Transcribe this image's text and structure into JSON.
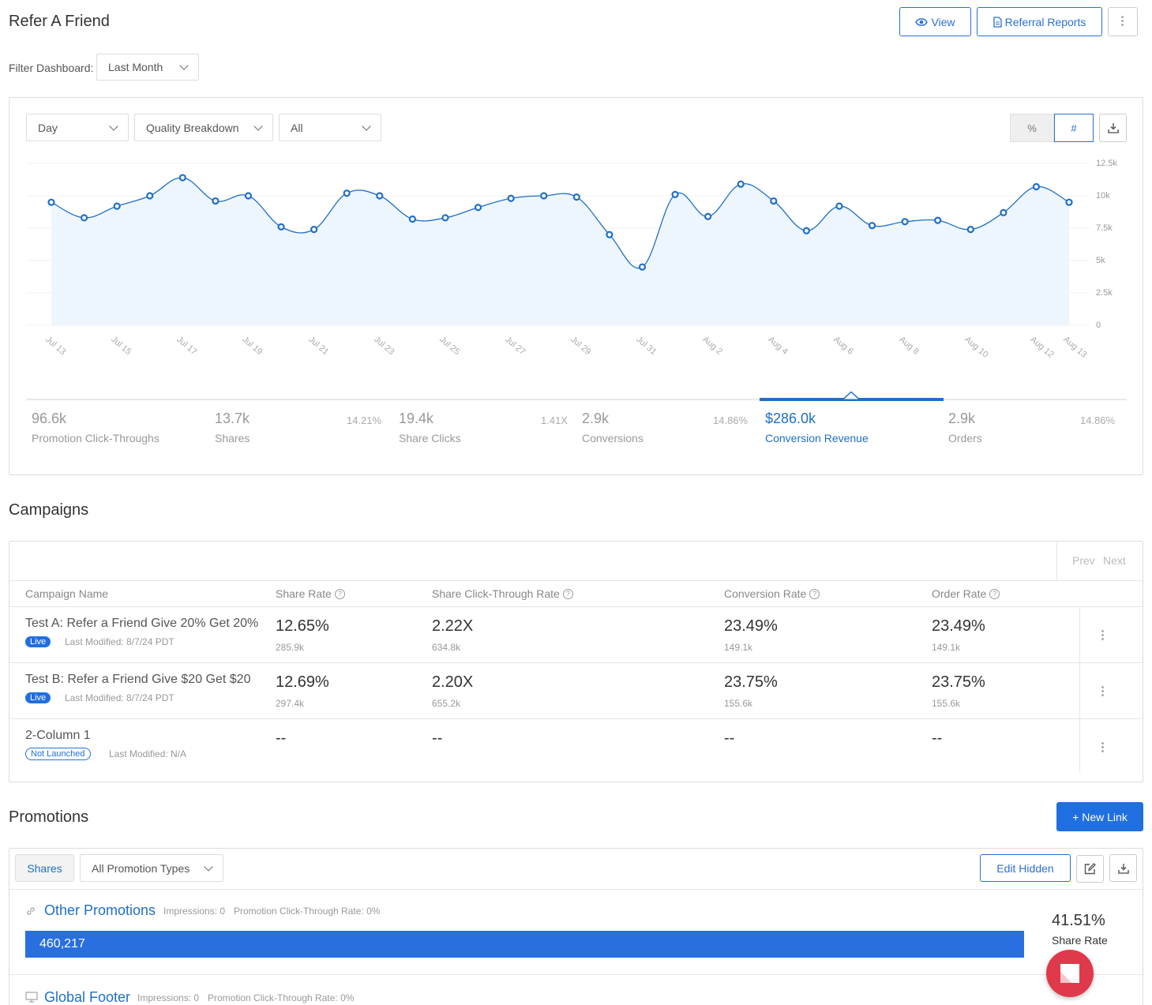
{
  "header": {
    "title": "Refer A Friend",
    "view_label": "View",
    "reports_label": "Referral Reports"
  },
  "filter": {
    "label": "Filter Dashboard:",
    "value": "Last Month"
  },
  "chart_controls": {
    "interval": "Day",
    "breakdown": "Quality Breakdown",
    "scope": "All",
    "percent_label": "%",
    "number_label": "#"
  },
  "chart_data": {
    "type": "area",
    "x": [
      "Jul 13",
      "Jul 14",
      "Jul 15",
      "Jul 16",
      "Jul 17",
      "Jul 18",
      "Jul 19",
      "Jul 20",
      "Jul 21",
      "Jul 22",
      "Jul 23",
      "Jul 24",
      "Jul 25",
      "Jul 26",
      "Jul 27",
      "Jul 28",
      "Jul 29",
      "Jul 30",
      "Jul 31",
      "Aug 1",
      "Aug 2",
      "Aug 3",
      "Aug 4",
      "Aug 5",
      "Aug 6",
      "Aug 7",
      "Aug 8",
      "Aug 9",
      "Aug 10",
      "Aug 11",
      "Aug 12",
      "Aug 13"
    ],
    "tick_labels": [
      "Jul 13",
      "Jul 15",
      "Jul 17",
      "Jul 19",
      "Jul 21",
      "Jul 23",
      "Jul 25",
      "Jul 27",
      "Jul 29",
      "Jul 31",
      "Aug 2",
      "Aug 4",
      "Aug 6",
      "Aug 8",
      "Aug 10",
      "Aug 12",
      "Aug 13"
    ],
    "y_ticks": [
      "12.5k",
      "10k",
      "7.5k",
      "5k",
      "2.5k",
      "0"
    ],
    "values": [
      9500,
      8300,
      9200,
      10000,
      11400,
      9600,
      10000,
      7600,
      7400,
      10200,
      10000,
      8200,
      8300,
      9100,
      9800,
      10000,
      9900,
      7000,
      4500,
      10100,
      8400,
      10900,
      9600,
      7300,
      9200,
      7700,
      8000,
      8100,
      7400,
      8700,
      10700,
      9500
    ],
    "ylim": [
      0,
      12500
    ],
    "grid": true,
    "line_color": "#1f6fc6",
    "fill_color": "#eef6fd"
  },
  "stats": [
    {
      "value": "96.6k",
      "label": "Promotion Click-Throughs",
      "rate": ""
    },
    {
      "value": "13.7k",
      "label": "Shares",
      "rate": "14.21%"
    },
    {
      "value": "19.4k",
      "label": "Share Clicks",
      "rate": "1.41X"
    },
    {
      "value": "2.9k",
      "label": "Conversions",
      "rate": "14.86%"
    },
    {
      "value": "$286.0k",
      "label": "Conversion Revenue",
      "rate": ""
    },
    {
      "value": "2.9k",
      "label": "Orders",
      "rate": "14.86%"
    }
  ],
  "campaigns": {
    "title": "Campaigns",
    "prev": "Prev",
    "next": "Next",
    "headers": [
      "Campaign Name",
      "Share Rate",
      "Share Click-Through Rate",
      "Conversion Rate",
      "Order Rate"
    ],
    "rows": [
      {
        "name": "Test A: Refer a Friend Give 20% Get 20%",
        "status": "Live",
        "modified": "Last Modified: 8/7/24 PDT",
        "share_rate": "12.65%",
        "share_rate_sub": "285.9k",
        "sctr": "2.22X",
        "sctr_sub": "634.8k",
        "conv": "23.49%",
        "conv_sub": "149.1k",
        "order": "23.49%",
        "order_sub": "149.1k"
      },
      {
        "name": "Test B: Refer a Friend Give $20 Get $20",
        "status": "Live",
        "modified": "Last Modified: 8/7/24 PDT",
        "share_rate": "12.69%",
        "share_rate_sub": "297.4k",
        "sctr": "2.20X",
        "sctr_sub": "655.2k",
        "conv": "23.75%",
        "conv_sub": "155.6k",
        "order": "23.75%",
        "order_sub": "155.6k"
      },
      {
        "name": "2-Column 1",
        "status": "Not Launched",
        "modified": "Last Modified: N/A",
        "share_rate": "--",
        "share_rate_sub": "",
        "sctr": "--",
        "sctr_sub": "",
        "conv": "--",
        "conv_sub": "",
        "order": "--",
        "order_sub": ""
      }
    ]
  },
  "promotions": {
    "title": "Promotions",
    "new_link": "+ New Link",
    "tab_shares": "Shares",
    "type_filter": "All Promotion Types",
    "edit_hidden": "Edit Hidden",
    "items": [
      {
        "name": "Other Promotions",
        "impressions": "Impressions: 0",
        "ctr": "Promotion Click-Through Rate: 0%",
        "bar_value": "460,217",
        "bar_fraction": 1.0,
        "rate": "41.51%",
        "rate_label": "Share Rate"
      },
      {
        "name": "Global Footer",
        "impressions": "Impressions: 0",
        "ctr": "Promotion Click-Through Rate: 0%"
      }
    ]
  }
}
